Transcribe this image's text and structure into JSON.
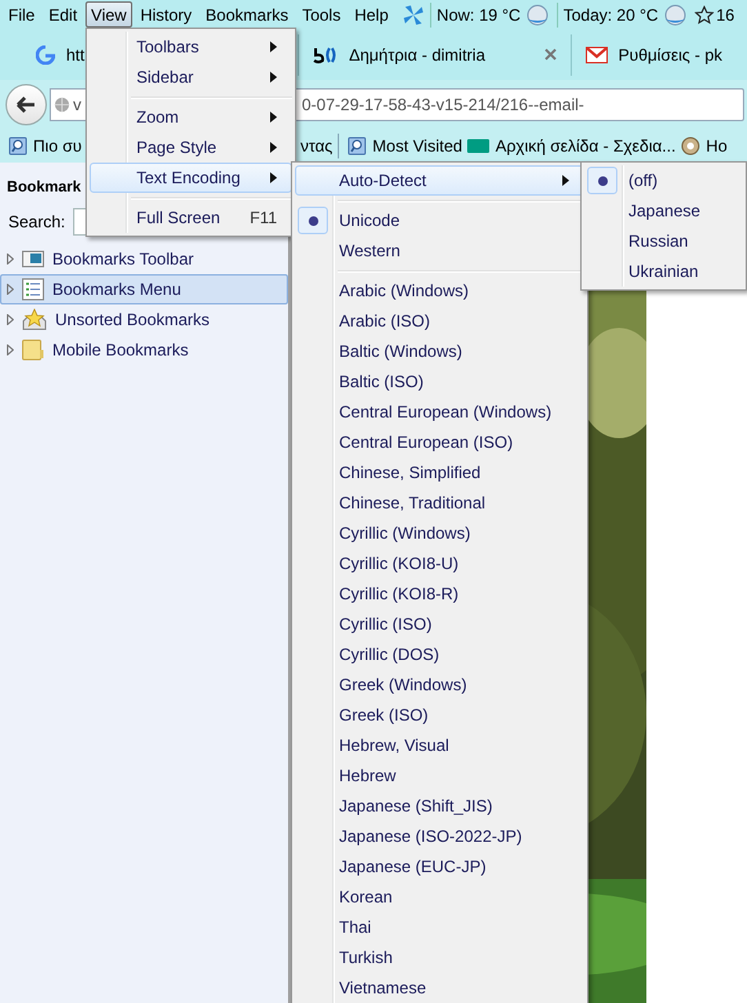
{
  "menu_bar": [
    {
      "label": "File",
      "selected": false
    },
    {
      "label": "Edit",
      "selected": false
    },
    {
      "label": "View",
      "selected": true
    },
    {
      "label": "History",
      "selected": false
    },
    {
      "label": "Bookmarks",
      "selected": false
    },
    {
      "label": "Tools",
      "selected": false
    },
    {
      "label": "Help",
      "selected": false
    }
  ],
  "weather": {
    "now": "Now: 19 °C",
    "today": "Today: 20 °C",
    "rating": "16"
  },
  "tabs": [
    {
      "label": "htt",
      "kind": "google",
      "close_button": false
    },
    {
      "label": "Δημήτρια - dimitria",
      "kind": "site",
      "close_button": true
    },
    {
      "label": "Ρυθμίσεις - pk",
      "kind": "mail",
      "close_button": false
    }
  ],
  "address_bar": {
    "text_start": "v",
    "text_end": "0-07-29-17-58-43-v15-214/216--email-"
  },
  "bookmarks_toolbar": [
    {
      "label": "Πιο συ",
      "kind": "page"
    },
    {
      "label": "ντας",
      "kind": "text"
    },
    {
      "label": "Most Visited",
      "kind": "page"
    },
    {
      "label": "Αρχική σελίδα - Σχεδια...",
      "kind": "wilo"
    },
    {
      "label": "Ho",
      "kind": "globe"
    }
  ],
  "sidebar": {
    "title": "Bookmark",
    "search_label": "Search:",
    "items": [
      {
        "label": "Bookmarks Toolbar",
        "kind": "toolbar",
        "selected": false
      },
      {
        "label": "Bookmarks Menu",
        "kind": "menu",
        "selected": true
      },
      {
        "label": "Unsorted Bookmarks",
        "kind": "unsorted",
        "selected": false
      },
      {
        "label": "Mobile Bookmarks",
        "kind": "folder",
        "selected": false
      }
    ]
  },
  "view_menu": [
    {
      "kind": "item",
      "label": "Toolbars",
      "submenu": true,
      "selected": false
    },
    {
      "kind": "item",
      "label": "Sidebar",
      "submenu": true,
      "selected": false
    },
    {
      "kind": "separator"
    },
    {
      "kind": "item",
      "label": "Zoom",
      "submenu": true,
      "selected": false
    },
    {
      "kind": "item",
      "label": "Page Style",
      "submenu": true,
      "selected": false
    },
    {
      "kind": "item",
      "label": "Text Encoding",
      "submenu": true,
      "selected": true
    },
    {
      "kind": "separator"
    },
    {
      "kind": "item",
      "label": "Full Screen",
      "shortcut": "F11",
      "submenu": false,
      "selected": false
    }
  ],
  "encoding_menu": [
    {
      "kind": "item",
      "label": "Auto-Detect",
      "submenu": true,
      "selected": true,
      "checked": false
    },
    {
      "kind": "separator"
    },
    {
      "kind": "item",
      "label": "Unicode",
      "submenu": false,
      "selected": false,
      "checked": true
    },
    {
      "kind": "item",
      "label": "Western",
      "submenu": false,
      "selected": false,
      "checked": false
    },
    {
      "kind": "separator"
    },
    {
      "kind": "item",
      "label": "Arabic (Windows)",
      "submenu": false,
      "selected": false,
      "checked": false
    },
    {
      "kind": "item",
      "label": "Arabic (ISO)",
      "submenu": false,
      "selected": false,
      "checked": false
    },
    {
      "kind": "item",
      "label": "Baltic (Windows)",
      "submenu": false,
      "selected": false,
      "checked": false
    },
    {
      "kind": "item",
      "label": "Baltic (ISO)",
      "submenu": false,
      "selected": false,
      "checked": false
    },
    {
      "kind": "item",
      "label": "Central European (Windows)",
      "submenu": false,
      "selected": false,
      "checked": false
    },
    {
      "kind": "item",
      "label": "Central European (ISO)",
      "submenu": false,
      "selected": false,
      "checked": false
    },
    {
      "kind": "item",
      "label": "Chinese, Simplified",
      "submenu": false,
      "selected": false,
      "checked": false
    },
    {
      "kind": "item",
      "label": "Chinese, Traditional",
      "submenu": false,
      "selected": false,
      "checked": false
    },
    {
      "kind": "item",
      "label": "Cyrillic (Windows)",
      "submenu": false,
      "selected": false,
      "checked": false
    },
    {
      "kind": "item",
      "label": "Cyrillic (KOI8-U)",
      "submenu": false,
      "selected": false,
      "checked": false
    },
    {
      "kind": "item",
      "label": "Cyrillic (KOI8-R)",
      "submenu": false,
      "selected": false,
      "checked": false
    },
    {
      "kind": "item",
      "label": "Cyrillic (ISO)",
      "submenu": false,
      "selected": false,
      "checked": false
    },
    {
      "kind": "item",
      "label": "Cyrillic (DOS)",
      "submenu": false,
      "selected": false,
      "checked": false
    },
    {
      "kind": "item",
      "label": "Greek (Windows)",
      "submenu": false,
      "selected": false,
      "checked": false
    },
    {
      "kind": "item",
      "label": "Greek (ISO)",
      "submenu": false,
      "selected": false,
      "checked": false
    },
    {
      "kind": "item",
      "label": "Hebrew, Visual",
      "submenu": false,
      "selected": false,
      "checked": false
    },
    {
      "kind": "item",
      "label": "Hebrew",
      "submenu": false,
      "selected": false,
      "checked": false
    },
    {
      "kind": "item",
      "label": "Japanese (Shift_JIS)",
      "submenu": false,
      "selected": false,
      "checked": false
    },
    {
      "kind": "item",
      "label": "Japanese (ISO-2022-JP)",
      "submenu": false,
      "selected": false,
      "checked": false
    },
    {
      "kind": "item",
      "label": "Japanese (EUC-JP)",
      "submenu": false,
      "selected": false,
      "checked": false
    },
    {
      "kind": "item",
      "label": "Korean",
      "submenu": false,
      "selected": false,
      "checked": false
    },
    {
      "kind": "item",
      "label": "Thai",
      "submenu": false,
      "selected": false,
      "checked": false
    },
    {
      "kind": "item",
      "label": "Turkish",
      "submenu": false,
      "selected": false,
      "checked": false
    },
    {
      "kind": "item",
      "label": "Vietnamese",
      "submenu": false,
      "selected": false,
      "checked": false
    }
  ],
  "autodetect_menu": [
    {
      "kind": "item",
      "label": "(off)",
      "submenu": false,
      "selected": false,
      "checked": true
    },
    {
      "kind": "item",
      "label": "Japanese",
      "submenu": false,
      "selected": false,
      "checked": false
    },
    {
      "kind": "item",
      "label": "Russian",
      "submenu": false,
      "selected": false,
      "checked": false
    },
    {
      "kind": "item",
      "label": "Ukrainian",
      "submenu": false,
      "selected": false,
      "checked": false
    }
  ]
}
